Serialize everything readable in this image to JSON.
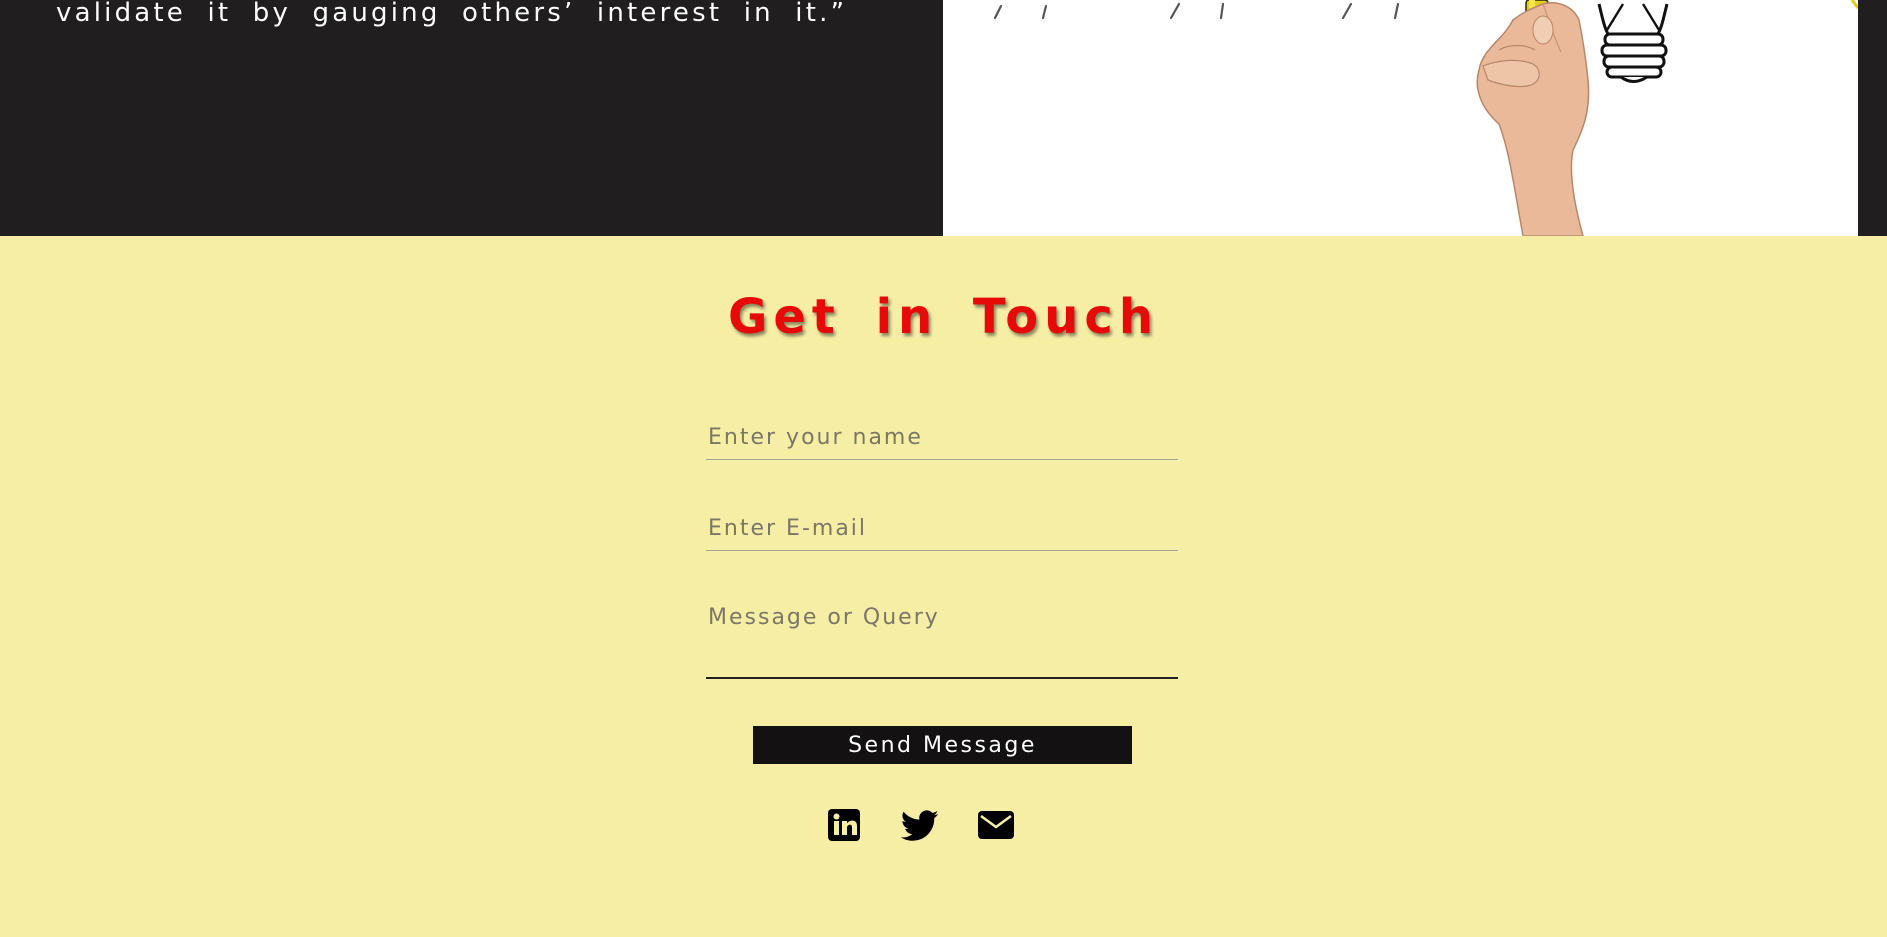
{
  "hero": {
    "quote_text": "validate it by gauging others’ interest in it.”"
  },
  "contact": {
    "title": "Get in Touch",
    "name_placeholder": "Enter your name",
    "email_placeholder": "Enter E-mail",
    "message_placeholder": "Message or Query",
    "send_label": "Send Message"
  },
  "socials": [
    {
      "icon": "linkedin-icon"
    },
    {
      "icon": "twitter-icon"
    },
    {
      "icon": "envelope-icon"
    }
  ],
  "colors": {
    "dark_background": "#201e1f",
    "contact_background": "#f7eea6",
    "title_red": "#e60a0a",
    "button_black": "#131111"
  }
}
